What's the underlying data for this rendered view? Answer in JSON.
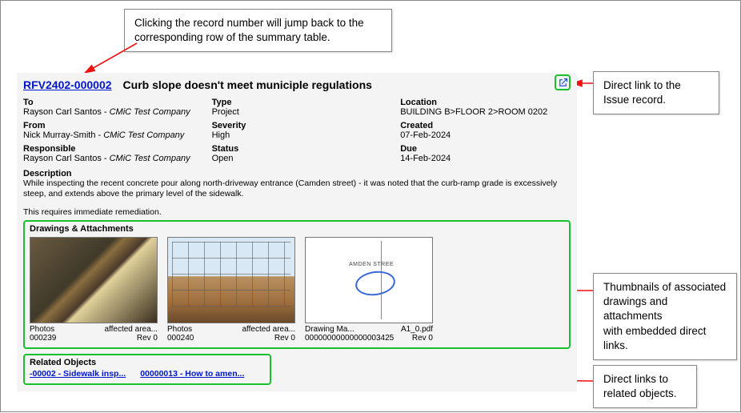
{
  "record": {
    "id": "RFV2402-000002",
    "title": "Curb slope doesn't meet municiple regulations",
    "to": {
      "label": "To",
      "name": "Rayson Carl Santos",
      "company": "CMiC Test Company"
    },
    "from": {
      "label": "From",
      "name": "Nick Murray-Smith",
      "company": "CMiC Test Company"
    },
    "responsible": {
      "label": "Responsible",
      "name": "Rayson Carl Santos",
      "company": "CMiC Test Company"
    },
    "type": {
      "label": "Type",
      "value": "Project"
    },
    "severity": {
      "label": "Severity",
      "value": "High"
    },
    "status": {
      "label": "Status",
      "value": "Open"
    },
    "location": {
      "label": "Location",
      "value": "BUILDING B>FLOOR 2>ROOM 0202"
    },
    "created": {
      "label": "Created",
      "value": "07-Feb-2024"
    },
    "due": {
      "label": "Due",
      "value": "14-Feb-2024"
    },
    "description_label": "Description",
    "description": "While inspecting the recent concrete pour along north-driveway entrance (Camden street) - it was noted that the curb-ramp grade is excessively steep, and extends above the primary level of the sidewalk.",
    "remediation": "This requires immediate remediation."
  },
  "attachments": {
    "heading": "Drawings & Attachments",
    "items": [
      {
        "cat": "Photos",
        "title": "affected area...",
        "code": "000239",
        "rev": "Rev 0"
      },
      {
        "cat": "Photos",
        "title": "affected area...",
        "code": "000240",
        "rev": "Rev 0"
      },
      {
        "cat": "Drawing Ma...",
        "title": "A1_0.pdf",
        "code": "00000000000000003425",
        "rev": "Rev 0"
      }
    ],
    "drawing_label": "AMDEN STREE"
  },
  "related": {
    "heading": "Related Objects",
    "links": [
      "-00002 - Sidewalk insp...",
      "00000013 - How to amen..."
    ]
  },
  "callouts": {
    "top": "Clicking the record number will jump back to the corresponding row of the summary table.",
    "right_top_1": "Direct link to the",
    "right_top_2": "Issue record.",
    "right_mid_1": "Thumbnails of associated",
    "right_mid_2": "drawings and attachments",
    "right_mid_3": "with embedded direct links.",
    "right_bot_1": "Direct links to",
    "right_bot_2": "related objects."
  }
}
